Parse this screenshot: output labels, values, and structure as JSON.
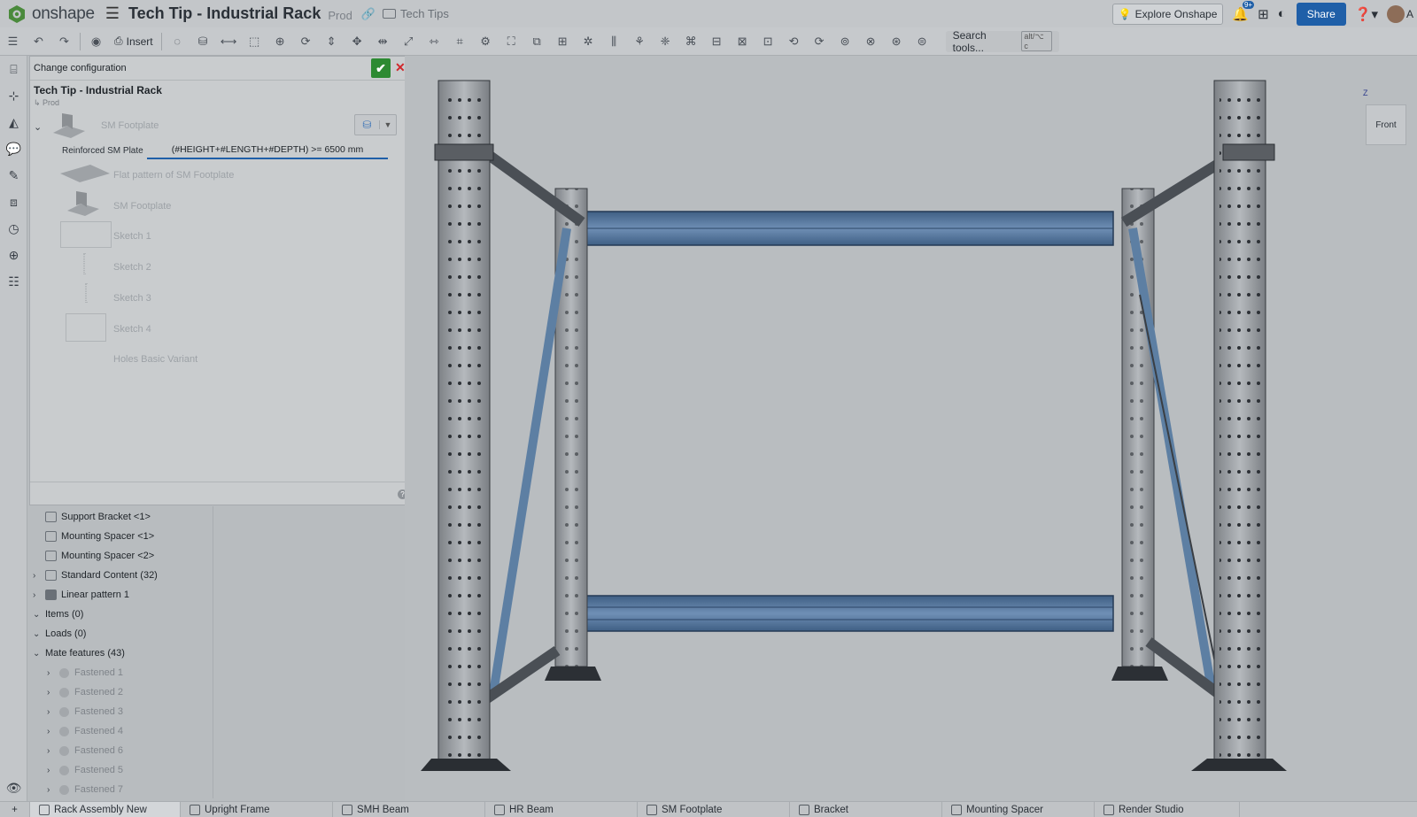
{
  "app": {
    "logo_text": "onshape",
    "doc_title": "Tech Tip - Industrial Rack",
    "branch": "Prod",
    "folder": "Tech Tips"
  },
  "topright": {
    "explore_label": "Explore Onshape",
    "notif_badge": "9+",
    "share_label": "Share",
    "user_initial": "A"
  },
  "toolbar": {
    "insert_label": "Insert",
    "search_label": "Search tools...",
    "search_shortcut": "alt/⌥ c"
  },
  "config": {
    "header": "Change configuration",
    "ok_icon": "✔",
    "cancel_icon": "✕",
    "title": "Tech Tip - Industrial Rack",
    "branch": "↳ Prod",
    "top_part": "SM Footplate",
    "reinforced_label": "Reinforced SM Plate",
    "expression": "(#HEIGHT+#LENGTH+#DEPTH) >= 6500 mm",
    "features": [
      "Flat pattern of SM Footplate",
      "SM Footplate",
      "Sketch 1",
      "Sketch 2",
      "Sketch 3",
      "Sketch 4",
      "Holes Basic Variant"
    ]
  },
  "tree": {
    "items": [
      {
        "label": "Support Bracket <1>"
      },
      {
        "label": "Mounting Spacer <1>"
      },
      {
        "label": "Mounting Spacer <2>"
      },
      {
        "label": "Standard Content (32)"
      },
      {
        "label": "Linear pattern 1"
      },
      {
        "label": "Items (0)"
      },
      {
        "label": "Loads (0)"
      },
      {
        "label": "Mate features (43)"
      },
      {
        "label": "Fastened 1"
      },
      {
        "label": "Fastened 2"
      },
      {
        "label": "Fastened 3"
      },
      {
        "label": "Fastened 4"
      },
      {
        "label": "Fastened 6"
      },
      {
        "label": "Fastened 5"
      },
      {
        "label": "Fastened 7"
      }
    ]
  },
  "viewcube": {
    "face": "Front",
    "axis": "Z"
  },
  "tabs": [
    {
      "label": "Rack Assembly New"
    },
    {
      "label": "Upright Frame"
    },
    {
      "label": "SMH Beam"
    },
    {
      "label": "HR Beam"
    },
    {
      "label": "SM Footplate"
    },
    {
      "label": "Bracket"
    },
    {
      "label": "Mounting Spacer"
    },
    {
      "label": "Render Studio"
    }
  ],
  "colors": {
    "accent": "#1f5fa8",
    "ok": "#2d8a32",
    "cancel": "#d0282c",
    "beam_blue": "#5d7fa3"
  }
}
